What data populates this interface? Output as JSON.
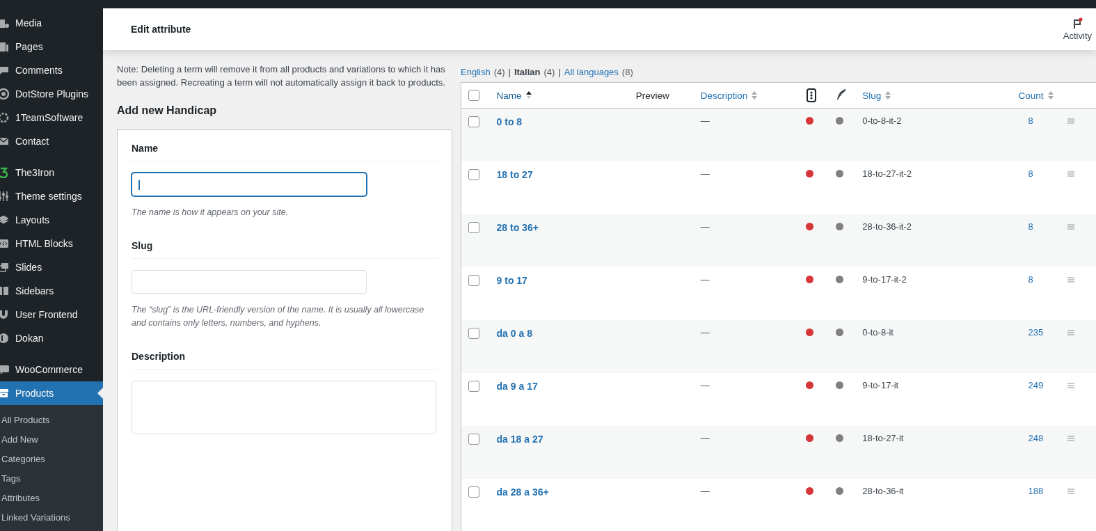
{
  "sidebar": {
    "sections": [
      {
        "items": [
          {
            "label": "Media",
            "selected": false
          },
          {
            "label": "Pages",
            "selected": false
          },
          {
            "label": "Comments",
            "selected": false
          },
          {
            "label": "DotStore Plugins",
            "selected": false
          },
          {
            "label": "1TeamSoftware",
            "selected": false
          },
          {
            "label": "Contact",
            "selected": false
          }
        ]
      },
      {
        "items": [
          {
            "label": "The3Iron",
            "selected": false
          },
          {
            "label": "Theme settings",
            "selected": false
          },
          {
            "label": "Layouts",
            "selected": false
          },
          {
            "label": "HTML Blocks",
            "selected": false
          },
          {
            "label": "Slides",
            "selected": false
          },
          {
            "label": "Sidebars",
            "selected": false
          },
          {
            "label": "User Frontend",
            "selected": false
          },
          {
            "label": "Dokan",
            "selected": false
          }
        ]
      },
      {
        "items": [
          {
            "label": "WooCommerce",
            "selected": false
          },
          {
            "label": "Products",
            "selected": true,
            "children": [
              {
                "label": "All Products",
                "selected": false
              },
              {
                "label": "Add New",
                "selected": false
              },
              {
                "label": "Categories",
                "selected": false
              },
              {
                "label": "Tags",
                "selected": false
              },
              {
                "label": "Attributes",
                "selected": false
              },
              {
                "label": "Linked Variations",
                "selected": false
              }
            ]
          }
        ]
      }
    ]
  },
  "header": {
    "title": "Edit attribute",
    "activity": {
      "label": "Activity",
      "unread": true
    }
  },
  "form": {
    "note": "Note: Deleting a term will remove it from all products and variations to which it has been assigned. Recreating a term will not automatically assign it back to products.",
    "heading": "Add new Handicap",
    "fields": [
      {
        "kind": "input",
        "label": "Name",
        "focused": true,
        "help": "The name is how it appears on your site."
      },
      {
        "kind": "input",
        "label": "Slug",
        "focused": false,
        "help": "The “slug” is the URL-friendly version of the name. It is usually all lowercase and contains only letters, numbers, and hyphens."
      },
      {
        "kind": "textarea",
        "label": "Description",
        "focused": false
      }
    ]
  },
  "languages": [
    {
      "label": "English",
      "count": "(4)",
      "divider": "|",
      "selected": false
    },
    {
      "label": "Italian",
      "count": "(4)",
      "divider": "|",
      "selected": true
    },
    {
      "label": "All languages",
      "count": "(8)",
      "selected": false
    }
  ],
  "table": {
    "columns": [
      {
        "kind": "check",
        "checked": false
      },
      {
        "kind": "text",
        "label": "Name",
        "sortable": true,
        "sorted": true
      },
      {
        "kind": "text",
        "label": "Preview",
        "sortable": false
      },
      {
        "kind": "text",
        "label": "Description",
        "sortable": true,
        "sorted": false
      },
      {
        "kind": "icon"
      },
      {
        "kind": "icon"
      },
      {
        "kind": "text",
        "label": "Slug",
        "sortable": true,
        "sorted": false
      },
      {
        "kind": "text",
        "label": "Count",
        "sortable": true,
        "sorted": false
      }
    ],
    "rows": [
      {
        "checked": false,
        "name": "0 to 8",
        "description": "—",
        "markers": [
          {
            "color": "#d63638"
          },
          {
            "color": "#808080"
          }
        ],
        "slug": "0-to-8-it-2",
        "count": "8"
      },
      {
        "checked": false,
        "name": "18 to 27",
        "description": "—",
        "markers": [
          {
            "color": "#d63638"
          },
          {
            "color": "#808080"
          }
        ],
        "slug": "18-to-27-it-2",
        "count": "8"
      },
      {
        "checked": false,
        "name": "28 to 36+",
        "description": "—",
        "markers": [
          {
            "color": "#d63638"
          },
          {
            "color": "#808080"
          }
        ],
        "slug": "28-to-36-it-2",
        "count": "8"
      },
      {
        "checked": false,
        "name": "9 to 17",
        "description": "—",
        "markers": [
          {
            "color": "#d63638"
          },
          {
            "color": "#808080"
          }
        ],
        "slug": "9-to-17-it-2",
        "count": "8"
      },
      {
        "checked": false,
        "name": "da 0 a 8",
        "description": "—",
        "markers": [
          {
            "color": "#d63638"
          },
          {
            "color": "#808080"
          }
        ],
        "slug": "0-to-8-it",
        "count": "235"
      },
      {
        "checked": false,
        "name": "da 9 a 17",
        "description": "—",
        "markers": [
          {
            "color": "#d63638"
          },
          {
            "color": "#808080"
          }
        ],
        "slug": "9-to-17-it",
        "count": "249"
      },
      {
        "checked": false,
        "name": "da 18 a 27",
        "description": "—",
        "markers": [
          {
            "color": "#d63638"
          },
          {
            "color": "#808080"
          }
        ],
        "slug": "18-to-27-it",
        "count": "248"
      },
      {
        "checked": false,
        "name": "da 28 a 36+",
        "description": "—",
        "markers": [
          {
            "color": "#d63638"
          },
          {
            "color": "#808080"
          }
        ],
        "slug": "28-to-36-it",
        "count": "188"
      }
    ]
  }
}
